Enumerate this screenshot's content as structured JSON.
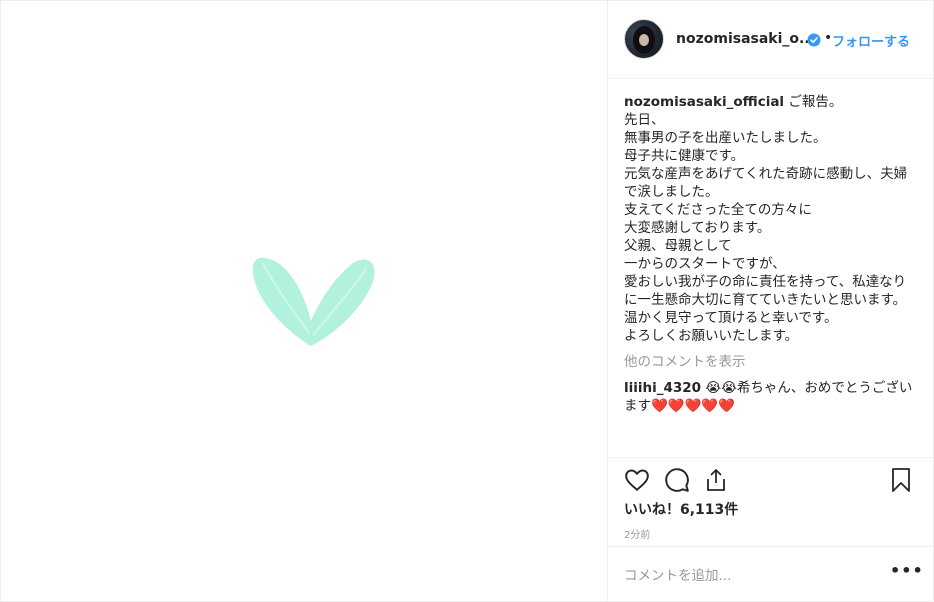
{
  "header": {
    "username_short": "nozomisasaki_o...",
    "dot": "•",
    "follow_label": "フォローする"
  },
  "caption": {
    "username": "nozomisasaki_official",
    "first_line": "ご報告。",
    "body": "\n先日、\n無事男の子を出産いたしました。\n母子共に健康です。\n元気な産声をあげてくれた奇跡に感動し、夫婦で涙しました。\n支えてくださった全ての方々に\n大変感謝しております。\n父親、母親として\n一からのスタートですが、\n愛おしい我が子の命に責任を持って、私達なりに一生懸命大切に育てていきたいと思います。\n温かく見守って頂けると幸いです。\nよろしくお願いいたします。"
  },
  "comments": {
    "more_label": "他のコメントを表示",
    "items": [
      {
        "username": "liiihi_4320",
        "text": "😭😭希ちゃん、おめでとうございます❤️❤️❤️❤️❤️"
      }
    ]
  },
  "stats": {
    "likes": "いいね！6,113件",
    "time": "2分前"
  },
  "composer": {
    "placeholder": "コメントを追加...",
    "more": "•••"
  },
  "colors": {
    "heart_mint": "#aef0dc",
    "link_blue": "#3897f0",
    "muted": "#999999"
  },
  "icons": [
    "verified-icon",
    "heart-icon",
    "comment-icon",
    "share-icon",
    "bookmark-icon",
    "more-options-icon"
  ]
}
